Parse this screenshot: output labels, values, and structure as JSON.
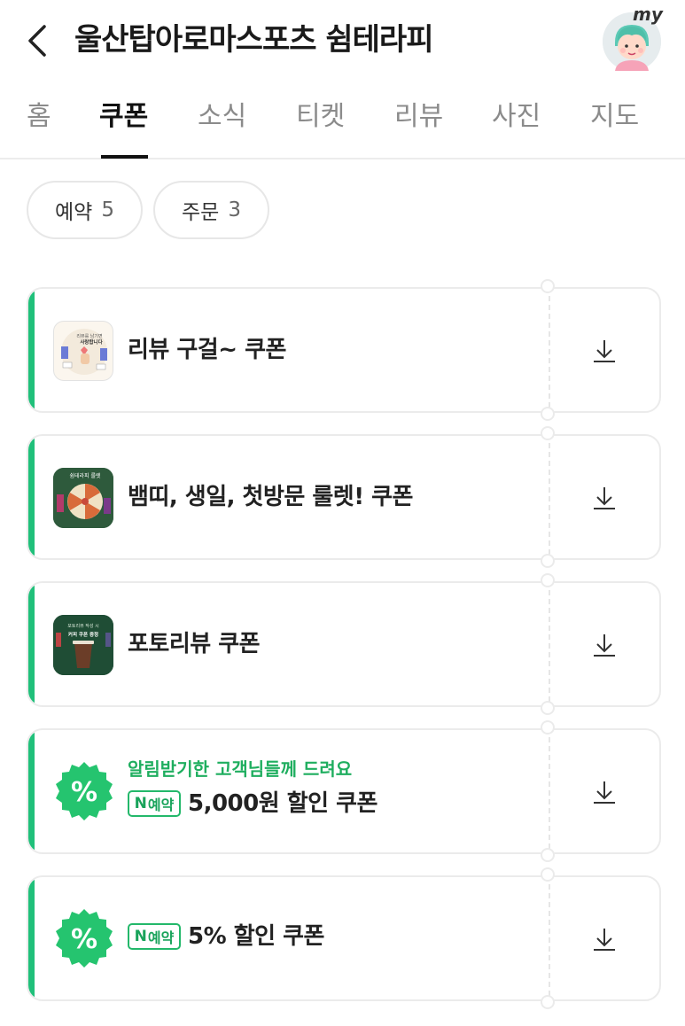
{
  "header": {
    "title": "울산탑아로마스포츠 쉼테라피",
    "my_badge": "my"
  },
  "tabs": [
    {
      "label": "홈",
      "active": false
    },
    {
      "label": "쿠폰",
      "active": true
    },
    {
      "label": "소식",
      "active": false
    },
    {
      "label": "티켓",
      "active": false
    },
    {
      "label": "리뷰",
      "active": false
    },
    {
      "label": "사진",
      "active": false
    },
    {
      "label": "지도",
      "active": false
    }
  ],
  "filters": [
    {
      "label": "예약",
      "count": "5"
    },
    {
      "label": "주문",
      "count": "3"
    }
  ],
  "coupons": [
    {
      "name": "리뷰 구걸~ 쿠폰",
      "thumb_text": [
        "리뷰를 남기면",
        "사랑합니다"
      ]
    },
    {
      "name": "뱀띠, 생일, 첫방문 룰렛! 쿠폰",
      "thumb_text": [
        "쉼테라피 룰렛"
      ]
    },
    {
      "name": "포토리뷰 쿠폰",
      "thumb_text": [
        "포토리뷰 작성 시",
        "커피 쿠폰 증정"
      ]
    },
    {
      "subtitle": "알림받기한 고객님들께 드려요",
      "badge": "예약",
      "badge_n": "N",
      "name": "5,000원 할인 쿠폰",
      "icon": "%"
    },
    {
      "badge": "예약",
      "badge_n": "N",
      "name": "5% 할인 쿠폰",
      "icon": "%"
    }
  ],
  "colors": {
    "accent": "#20c07a",
    "badge_green": "#23b86a",
    "subtitle_green": "#1fae5f"
  }
}
